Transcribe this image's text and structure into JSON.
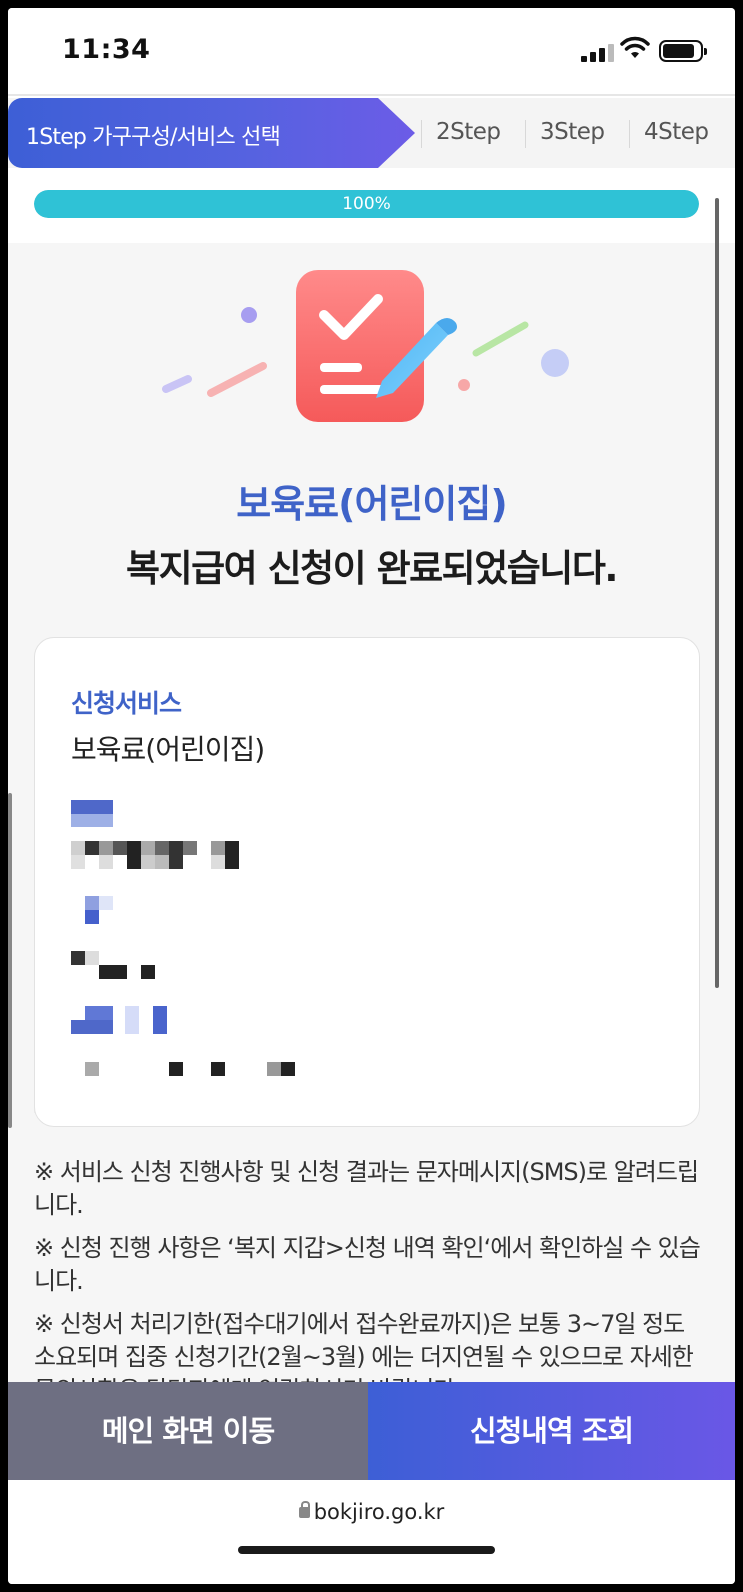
{
  "status_bar": {
    "time": "11:34"
  },
  "steps": {
    "step1": "1Step 가구구성/서비스 선택",
    "step2": "2Step",
    "step3": "3Step",
    "step4": "4Step"
  },
  "progress": {
    "label": "100%",
    "value": 1.0
  },
  "result": {
    "service_title": "보육료(어린이집)",
    "message": "복지급여 신청이 완료되었습니다."
  },
  "card": {
    "service_label": "신청서비스",
    "service_value": "보육료(어린이집)"
  },
  "notes": [
    "※ 서비스 신청 진행사항 및 신청 결과는 문자메시지(SMS)로 알려드립니다.",
    "※ 신청 진행 사항은 ‘복지 지갑>신청 내역 확인‘에서 확인하실 수 있습니다.",
    "※ 신청서 처리기한(접수대기에서 접수완료까지)은 보통 3~7일 정도 소요되며 집중 신청기간(2월~3월) 에는 더지연될 수 있으므로 자세한 문의사항은 담당자에게 연락하시기 바랍니다."
  ],
  "buttons": {
    "main": "메인 화면 이동",
    "history": "신청내역 조회"
  },
  "browser": {
    "url": "bokjiro.go.kr"
  },
  "colors": {
    "accent_blue": "#3f63c8",
    "progress": "#2fc2d6",
    "gray_button": "#6e6f82"
  }
}
